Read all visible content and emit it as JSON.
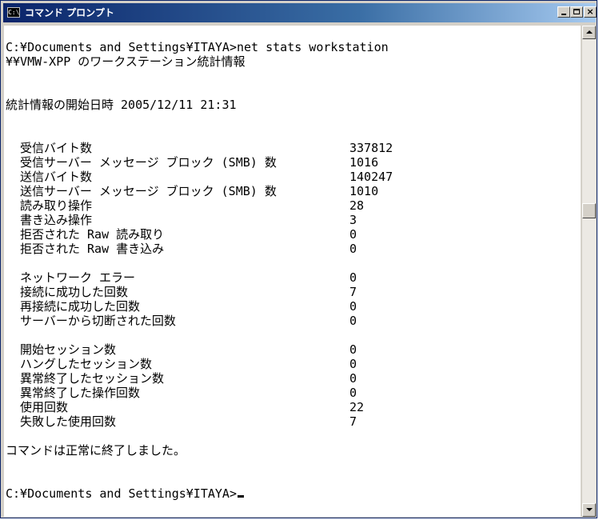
{
  "window": {
    "title": "コマンド プロンプト",
    "icon": "cmd-icon",
    "icon_text": "C:\\",
    "buttons": {
      "minimize": "minimize-icon",
      "maximize": "maximize-icon",
      "close": "close-icon",
      "close_glyph": "×"
    }
  },
  "console": {
    "command_line": "C:¥Documents and Settings¥ITAYA>net stats workstation",
    "header": "¥¥VMW-XPP のワークステーション統計情報",
    "since": "統計情報の開始日時 2005/12/11 21:31",
    "group1": [
      {
        "label": "受信バイト数",
        "value": "337812"
      },
      {
        "label": "受信サーバー メッセージ ブロック (SMB) 数",
        "value": "1016"
      },
      {
        "label": "送信バイト数",
        "value": "140247"
      },
      {
        "label": "送信サーバー メッセージ ブロック (SMB) 数",
        "value": "1010"
      },
      {
        "label": "読み取り操作",
        "value": "28"
      },
      {
        "label": "書き込み操作",
        "value": "3"
      },
      {
        "label": "拒否された Raw 読み取り",
        "value": "0"
      },
      {
        "label": "拒否された Raw 書き込み",
        "value": "0"
      }
    ],
    "group2": [
      {
        "label": "ネットワーク エラー",
        "value": "0"
      },
      {
        "label": "接続に成功した回数",
        "value": "7"
      },
      {
        "label": "再接続に成功した回数",
        "value": "0"
      },
      {
        "label": "サーバーから切断された回数",
        "value": "0"
      }
    ],
    "group3": [
      {
        "label": "開始セッション数",
        "value": "0"
      },
      {
        "label": "ハングしたセッション数",
        "value": "0"
      },
      {
        "label": "異常終了したセッション数",
        "value": "0"
      },
      {
        "label": "異常終了した操作回数",
        "value": "0"
      },
      {
        "label": "使用回数",
        "value": "22"
      },
      {
        "label": "失敗した使用回数",
        "value": "7"
      }
    ],
    "result": "コマンドは正常に終了しました。",
    "prompt": "C:¥Documents and Settings¥ITAYA>"
  },
  "scrollbar": {
    "up": "scroll-up-arrow-icon",
    "down": "scroll-down-arrow-icon"
  },
  "colors": {
    "title_bar_start": "#0a246a",
    "title_bar_end": "#a6caf0",
    "console_bg": "#ffffff",
    "console_fg": "#000000"
  }
}
